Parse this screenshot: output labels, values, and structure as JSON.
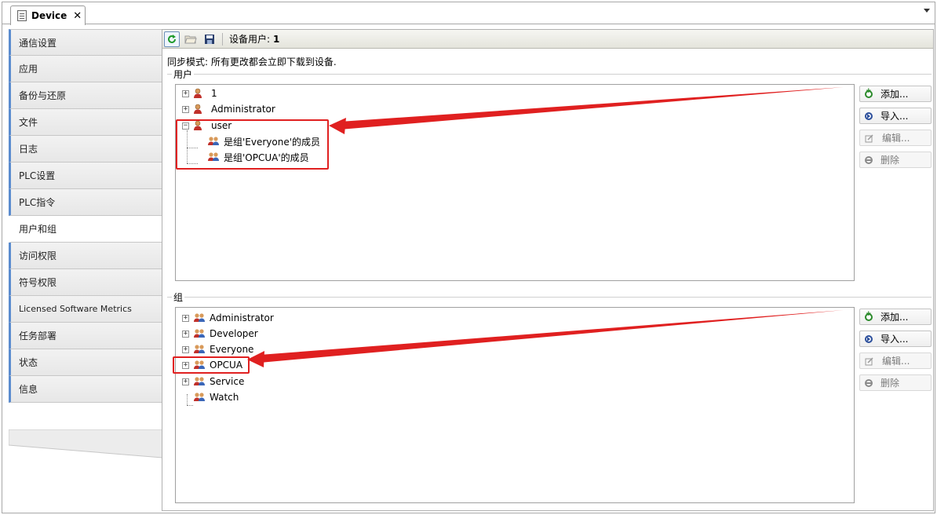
{
  "tab": {
    "title": "Device",
    "close": "✕"
  },
  "nav": {
    "items": [
      {
        "label": "通信设置"
      },
      {
        "label": "应用"
      },
      {
        "label": "备份与还原"
      },
      {
        "label": "文件"
      },
      {
        "label": "日志"
      },
      {
        "label": "PLC设置"
      },
      {
        "label": "PLC指令"
      },
      {
        "label": "用户和组",
        "active": true
      },
      {
        "label": "访问权限"
      },
      {
        "label": "符号权限"
      },
      {
        "label": "Licensed Software Metrics"
      },
      {
        "label": "任务部署"
      },
      {
        "label": "状态"
      },
      {
        "label": "信息"
      }
    ]
  },
  "toolbar": {
    "device_user_label": "设备用户:",
    "device_user_value": "1"
  },
  "sync_text": "同步模式: 所有更改都会立即下载到设备.",
  "users": {
    "title": "用户",
    "items": [
      {
        "name": "1",
        "expander": "+"
      },
      {
        "name": "Administrator",
        "expander": "+"
      },
      {
        "name": "user",
        "expander": "−"
      },
      {
        "name": "是组'Everyone'的成员"
      },
      {
        "name": "是组'OPCUA'的成员"
      }
    ],
    "buttons": {
      "add": "添加...",
      "import": "导入...",
      "edit": "编辑...",
      "delete": "删除"
    }
  },
  "groups": {
    "title": "组",
    "items": [
      {
        "name": "Administrator",
        "expander": "+"
      },
      {
        "name": "Developer",
        "expander": "+"
      },
      {
        "name": "Everyone",
        "expander": "+"
      },
      {
        "name": "OPCUA",
        "expander": "+"
      },
      {
        "name": "Service",
        "expander": "+"
      },
      {
        "name": "Watch"
      }
    ],
    "buttons": {
      "add": "添加...",
      "import": "导入...",
      "edit": "编辑...",
      "delete": "删除"
    }
  },
  "colors": {
    "accent": "#5b8ccf",
    "annotation": "#e02020"
  },
  "icons": {
    "refresh": "refresh-icon",
    "open": "folder-open-icon",
    "save": "save-icon",
    "user": "user-icon",
    "group": "group-icon"
  }
}
